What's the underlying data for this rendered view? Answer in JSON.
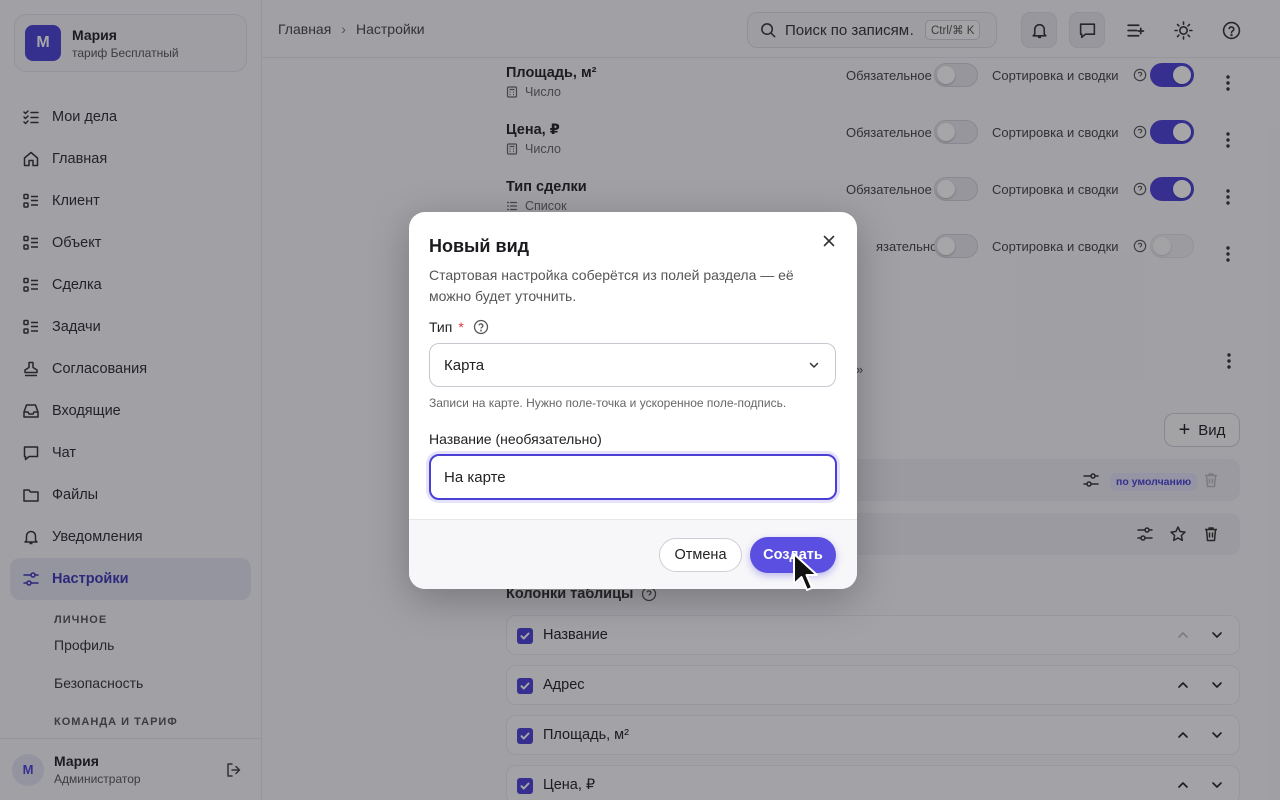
{
  "account": {
    "initial": "М",
    "name": "Мария",
    "plan": "тариф Бесплатный"
  },
  "nav": [
    {
      "label": "Мои дела",
      "icon": "checklist-icon"
    },
    {
      "label": "Главная",
      "icon": "home-icon"
    },
    {
      "label": "Клиент",
      "icon": "list-icon"
    },
    {
      "label": "Объект",
      "icon": "list-icon"
    },
    {
      "label": "Сделка",
      "icon": "list-icon"
    },
    {
      "label": "Задачи",
      "icon": "list-icon"
    },
    {
      "label": "Согласования",
      "icon": "stamp-icon"
    },
    {
      "label": "Входящие",
      "icon": "inbox-icon"
    },
    {
      "label": "Чат",
      "icon": "chat-icon"
    },
    {
      "label": "Файлы",
      "icon": "folder-icon"
    },
    {
      "label": "Уведомления",
      "icon": "bell-icon"
    },
    {
      "label": "Настройки",
      "icon": "sliders-icon"
    }
  ],
  "settings_sub": {
    "personal_heading": "ЛИЧНОЕ",
    "profile": "Профиль",
    "security": "Безопасность",
    "team_heading": "КОМАНДА И ТАРИФ"
  },
  "user": {
    "initial": "М",
    "name": "Мария",
    "role": "Администратор"
  },
  "breadcrumb": {
    "home": "Главная",
    "current": "Настройки"
  },
  "search": {
    "placeholder": "Поиск по записям…",
    "shortcut": "Ctrl/⌘ K"
  },
  "fields": [
    {
      "name": "Площадь, м²",
      "type": "Число",
      "required": false,
      "sort": true
    },
    {
      "name": "Цена, ₽",
      "type": "Число",
      "required": false,
      "sort": true
    },
    {
      "name": "Тип сделки",
      "type": "Список",
      "required": false,
      "sort": true
    },
    {
      "name": "",
      "type": "",
      "required": false,
      "sort": false
    }
  ],
  "labels": {
    "required": "Обязательное",
    "required_partial": "язательное",
    "sort": "Сортировка и сводки",
    "view_button": "Вид",
    "default_badge": "по умолчанию",
    "quote_fragment": "»",
    "columns_title": "Колонки таблицы"
  },
  "columns": [
    "Название",
    "Адрес",
    "Площадь, м²",
    "Цена, ₽"
  ],
  "modal": {
    "title": "Новый вид",
    "description": "Стартовая настройка соберётся из полей раздела — её можно будет уточнить.",
    "type_label": "Тип",
    "type_required_mark": "*",
    "type_value": "Карта",
    "type_hint": "Записи на карте. Нужно поле-точка и ускоренное поле-подпись.",
    "name_label": "Название (необязательно)",
    "name_value": "На карте",
    "cancel": "Отмена",
    "create": "Создать"
  },
  "colors": {
    "accent": "#4b40d6",
    "accent_button": "#5a4fe0",
    "required_star": "#d93a3a"
  }
}
